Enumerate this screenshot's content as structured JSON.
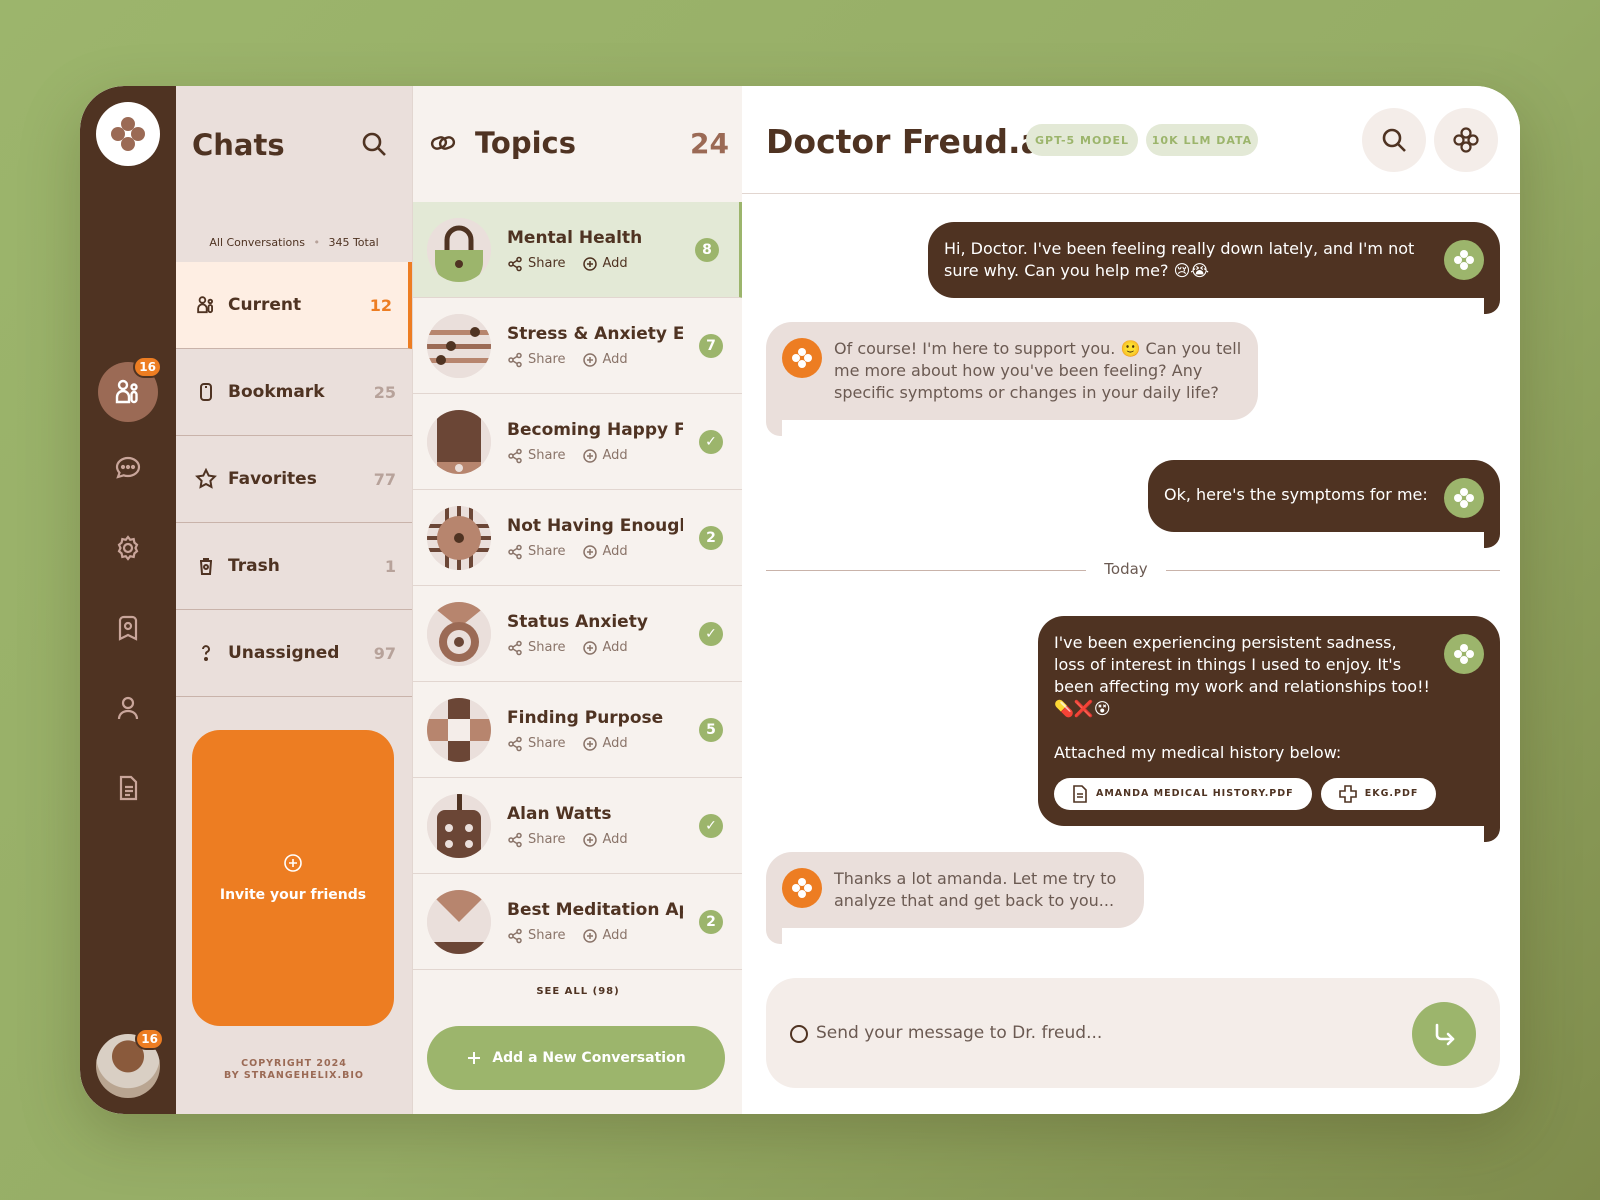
{
  "rail": {
    "badge_main": "16",
    "badge_avatar": "16"
  },
  "chats": {
    "title": "Chats",
    "subtitle_left": "All Conversations",
    "subtitle_right": "345 Total",
    "folders": [
      {
        "label": "Current",
        "count": "12",
        "icon": "users-icon"
      },
      {
        "label": "Bookmark",
        "count": "25",
        "icon": "bookmark-icon"
      },
      {
        "label": "Favorites",
        "count": "77",
        "icon": "star-icon"
      },
      {
        "label": "Trash",
        "count": "1",
        "icon": "trash-icon"
      },
      {
        "label": "Unassigned",
        "count": "97",
        "icon": "question-icon"
      }
    ],
    "invite_label": "Invite your friends",
    "copyright_line1": "COPYRIGHT 2024",
    "copyright_line2": "BY STRANGEHELIX.BIO"
  },
  "topics": {
    "title": "Topics",
    "count": "24",
    "share_label": "Share",
    "add_label": "Add",
    "items": [
      {
        "title": "Mental Health",
        "badge": "8"
      },
      {
        "title": "Stress & Anxiety Ev...",
        "badge": "7"
      },
      {
        "title": "Becoming Happy Fo...",
        "badge": "✓"
      },
      {
        "title": "Not Having Enough...",
        "badge": "2"
      },
      {
        "title": "Status Anxiety",
        "badge": "✓"
      },
      {
        "title": "Finding Purpose",
        "badge": "5"
      },
      {
        "title": "Alan Watts",
        "badge": "✓"
      },
      {
        "title": "Best Meditation Apps",
        "badge": "2"
      }
    ],
    "see_all": "SEE ALL (98)",
    "new_conversation": "Add a New Conversation"
  },
  "conversation": {
    "title": "Doctor Freud.ai",
    "pill_model": "GPT-5 MODEL",
    "pill_data": "10K LLM DATA",
    "messages": [
      {
        "text": "Hi, Doctor. I've been feeling really down lately, and I'm not sure why. Can you help me? 😢😭"
      },
      {
        "text": "Of course! I'm here to support you. 🙂 Can you tell me more about how you've been feeling? Any specific symptoms or changes in your daily life?"
      },
      {
        "text": "Ok, here's the symptoms for me:"
      },
      {
        "text": "I've been experiencing persistent sadness, loss of interest in things I used to enjoy. It's been affecting my work and relationships too!! 💊❌😵"
      },
      {
        "text": "Thanks a lot amanda. Let me try to analyze that and get back to you..."
      }
    ],
    "today_label": "Today",
    "attachment_intro": "Attached my medical history below:",
    "attachments": [
      "AMANDA MEDICAL HISTORY.PDF",
      "EKG.PDF"
    ],
    "composer_placeholder": "Send your message to Dr. freud..."
  },
  "colors": {
    "brown": "#4f3322",
    "orange": "#ed7d22",
    "green": "#9cb56c",
    "beige": "#eadfdb"
  }
}
